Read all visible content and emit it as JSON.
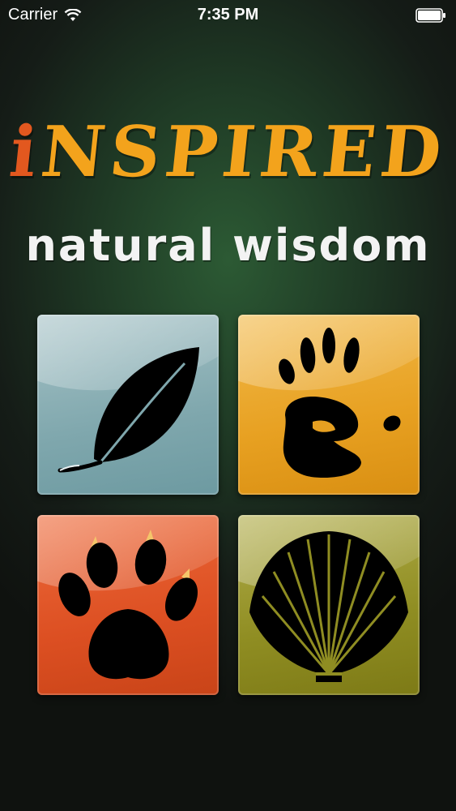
{
  "status_bar": {
    "carrier": "Carrier",
    "time": "7:35 PM",
    "icons": {
      "wifi": "wifi-icon",
      "battery": "battery-icon"
    }
  },
  "header": {
    "title_first": "i",
    "title_rest": "NSPIRED",
    "subtitle": "natural wisdom"
  },
  "tiles": [
    {
      "name": "leaf",
      "icon": "leaf-icon",
      "color": "#7fa7ad"
    },
    {
      "name": "hand",
      "icon": "hand-print-icon",
      "color": "#e7a021"
    },
    {
      "name": "paw",
      "icon": "paw-print-icon",
      "color": "#dc4f22"
    },
    {
      "name": "shell",
      "icon": "shell-icon",
      "color": "#8f8d22"
    }
  ],
  "colors": {
    "title_orange": "#f3a31c",
    "title_red": "#e2581f",
    "background": "#1f3a25"
  }
}
